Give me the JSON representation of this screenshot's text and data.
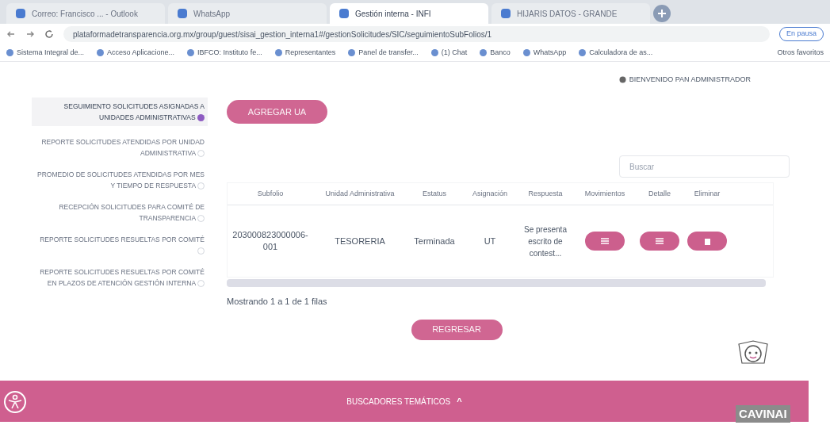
{
  "browser": {
    "tabs": [
      {
        "label": "Correo: Francisco ... - Outlook",
        "selected": false
      },
      {
        "label": "WhatsApp",
        "selected": false
      },
      {
        "label": "Gestión interna - INFI",
        "selected": true
      },
      {
        "label": "HIJARIS DATOS - GRANDE",
        "selected": false
      }
    ],
    "url": "plataformadetransparencia.org.mx/group/guest/sisai_gestion_interna1#/gestionSolicitudes/SIC/seguimientoSubFolios/1",
    "profile": "En pausa",
    "bookmarks": [
      "Sistema Integral de...",
      "Acceso Aplicacione...",
      "IBFCO: Instituto fe...",
      "Representantes",
      "Panel de transfer...",
      "(1) Chat",
      "Banco",
      "WhatsApp",
      "Calculadora de as..."
    ],
    "other_bookmarks": "Otros favoritos"
  },
  "welcome": "BIENVENIDO PAN ADMINISTRADOR",
  "sidebar": {
    "items": [
      {
        "label": "SEGUIMIENTO SOLICITUDES ASIGNADAS A UNIDADES ADMINISTRATIVAS",
        "selected": true
      },
      {
        "label": "REPORTE SOLICITUDES ATENDIDAS POR UNIDAD ADMINISTRATIVA",
        "selected": false
      },
      {
        "label": "PROMEDIO DE SOLICITUDES ATENDIDAS POR MES Y TIEMPO DE RESPUESTA",
        "selected": false
      },
      {
        "label": "RECEPCIÓN SOLICITUDES PARA COMITÉ DE TRANSPARENCIA",
        "selected": false
      },
      {
        "label": "REPORTE SOLICITUDES RESUELTAS POR COMITÉ",
        "selected": false
      },
      {
        "label": "REPORTE SOLICITUDES RESUELTAS POR COMITÉ EN PLAZOS DE ATENCIÓN GESTIÓN INTERNA",
        "selected": false
      }
    ]
  },
  "add_button": "AGREGAR UA",
  "search": {
    "placeholder": "Buscar"
  },
  "table": {
    "columns": [
      "Subfolio",
      "Unidad Administrativa",
      "Estatus",
      "Asignación",
      "Respuesta",
      "Movimientos",
      "Detalle",
      "Eliminar"
    ],
    "rows": [
      {
        "subfolio": "203000823000006-001",
        "unidad": "TESORERIA",
        "estatus": "Terminada",
        "asignacion": "UT",
        "respuesta": "Se presenta escrito de contest..."
      }
    ]
  },
  "pagination": "Mostrando 1 a 1 de 1 filas",
  "back_button": "REGRESAR",
  "footer": {
    "title": "BUSCADORES TEMÁTICOS",
    "chevron": "^",
    "logo": "CAVINAI"
  }
}
